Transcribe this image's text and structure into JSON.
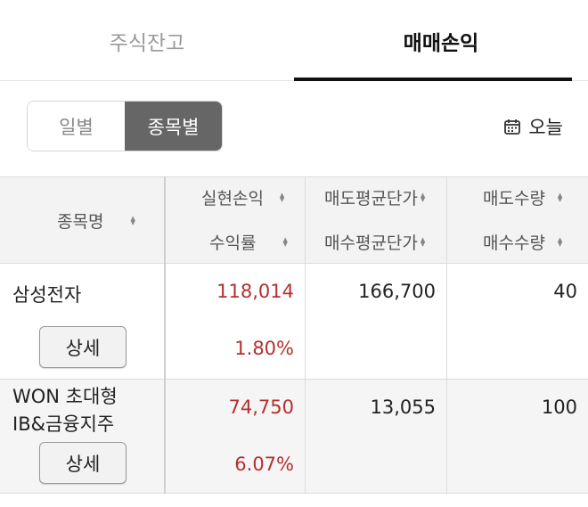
{
  "tabs": [
    {
      "label": "주식잔고",
      "active": false
    },
    {
      "label": "매매손익",
      "active": true
    }
  ],
  "segments": [
    {
      "label": "일별",
      "active": false
    },
    {
      "label": "종목별",
      "active": true
    }
  ],
  "date_filter": {
    "label": "오늘",
    "icon": "calendar-icon"
  },
  "table": {
    "headers": {
      "name": "종목명",
      "realized_pl": "실현손익",
      "return_rate": "수익률",
      "sell_avg_price": "매도평균단가",
      "buy_avg_price": "매수평균단가",
      "sell_qty": "매도수량",
      "buy_qty": "매수수량"
    },
    "sort_icon": "sort-arrows-icon",
    "rows": [
      {
        "name_line1": "삼성전자",
        "name_line2": "",
        "realized_pl": "118,014",
        "return_rate": "1.80%",
        "sell_avg_price": "166,700",
        "sell_qty": "40",
        "detail_label": "상세"
      },
      {
        "name_line1": "WON 초대형",
        "name_line2": "IB&금융지주",
        "realized_pl": "74,750",
        "return_rate": "6.07%",
        "sell_avg_price": "13,055",
        "sell_qty": "100",
        "detail_label": "상세"
      }
    ]
  },
  "colors": {
    "profit": "#b3302f",
    "active_segment": "#666666",
    "tab_active": "#111111",
    "tab_inactive": "#9a9a9a"
  }
}
